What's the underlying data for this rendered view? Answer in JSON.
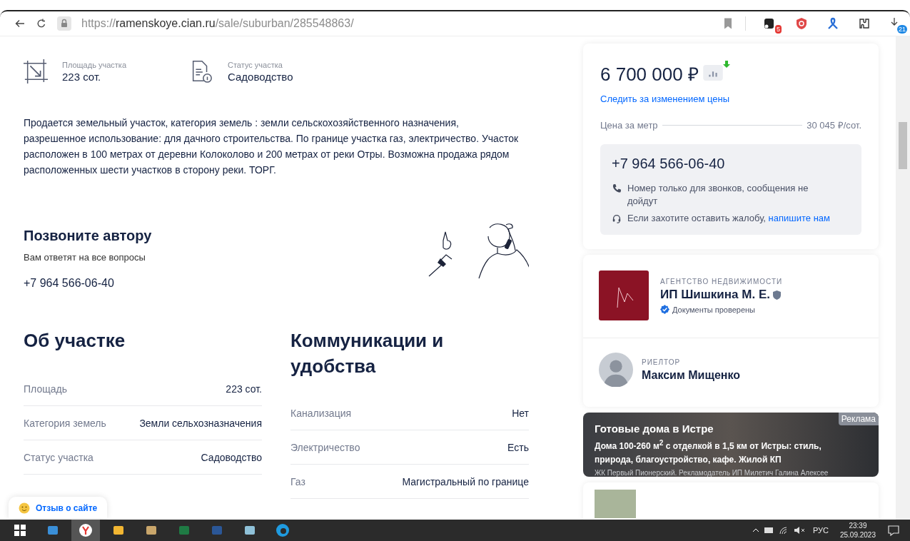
{
  "browser": {
    "url": {
      "scheme": "https://",
      "host": "ramenskoye.cian.ru",
      "path": "/sale/suburban/285548863/"
    },
    "extension_badges": [
      {
        "kind": "tabs",
        "badge": "5"
      },
      {
        "kind": "shield"
      },
      {
        "kind": "ribbon"
      },
      {
        "kind": "puzzle"
      },
      {
        "kind": "download",
        "badge": "21"
      }
    ]
  },
  "key_facts": [
    {
      "kind": "area",
      "label": "Площадь участка",
      "value": "223 сот."
    },
    {
      "kind": "status",
      "label": "Статус участка",
      "value": "Садоводство"
    }
  ],
  "description": "Продается земельный участок, категория земель : земли сельскохозяйственного назначения, разрешенное использование: для дачного строительства. По границе участка газ, электричество. Участок расположен в 100 метрах от деревни Колоколово и 200 метрах от реки Отры. Возможна продажа рядом расположенных шести участков в сторону реки. ТОРГ.",
  "call_author": {
    "title": "Позвоните автору",
    "subtitle": "Вам ответят на все вопросы",
    "phone": "+7 964 566-06-40"
  },
  "about": {
    "title": "Об участке",
    "rows": [
      {
        "label": "Площадь",
        "value": "223 сот."
      },
      {
        "label": "Категория земель",
        "value": "Земли сельхозназначения"
      },
      {
        "label": "Статус участка",
        "value": "Садоводство"
      }
    ]
  },
  "utilities": {
    "title": "Коммуникации и удобства",
    "rows": [
      {
        "label": "Канализация",
        "value": "Нет"
      },
      {
        "label": "Электричество",
        "value": "Есть"
      },
      {
        "label": "Газ",
        "value": "Магистральный по границе"
      }
    ]
  },
  "price_card": {
    "price": "6 700 000 ₽",
    "price_dropped": true,
    "track_link": "Следить за изменением цены",
    "per_unit_label": "Цена за метр",
    "per_unit_value": "30 045 ₽/сот.",
    "phone": "+7 964 566-06-40",
    "notes": [
      {
        "kind": "phone",
        "text": "Номер только для звонков, сообщения не дойдут"
      },
      {
        "kind": "support",
        "text": "Если захотите оставить жалобу,",
        "link": "напишите нам"
      }
    ]
  },
  "agency": {
    "caption": "АГЕНТСТВО НЕДВИЖИМОСТИ",
    "name": "ИП Шишкина М. Е.",
    "verified": true,
    "verified_text": "Документы проверены",
    "realtor_caption": "РИЕЛТОР",
    "realtor_name": "Максим Мищенко"
  },
  "ad": {
    "tag": "Реклама",
    "title": "Готовые дома в Истре",
    "text": "Дома 100-260 м$^{2}$ с отделкой в 1,5 км от Истры: стиль, природа, благоустройство, кафе. Жилой КП",
    "footer": "ЖК Первый Пионерский. Рекламодатель ИП Милетич Галина Алексее"
  },
  "feedback_button": "Отзыв о сайте",
  "taskbar": {
    "apps": [
      {
        "kind": "start",
        "selected": false
      },
      {
        "kind": "mail",
        "selected": false
      },
      {
        "kind": "browser",
        "selected": true
      },
      {
        "kind": "folder",
        "selected": false
      },
      {
        "kind": "paint",
        "selected": false
      },
      {
        "kind": "sheet",
        "selected": false
      },
      {
        "kind": "doc",
        "selected": false
      },
      {
        "kind": "notes",
        "selected": false
      },
      {
        "kind": "edge",
        "selected": false
      }
    ],
    "language": "РУС",
    "time": "23:39",
    "date": "25.09.2023"
  }
}
